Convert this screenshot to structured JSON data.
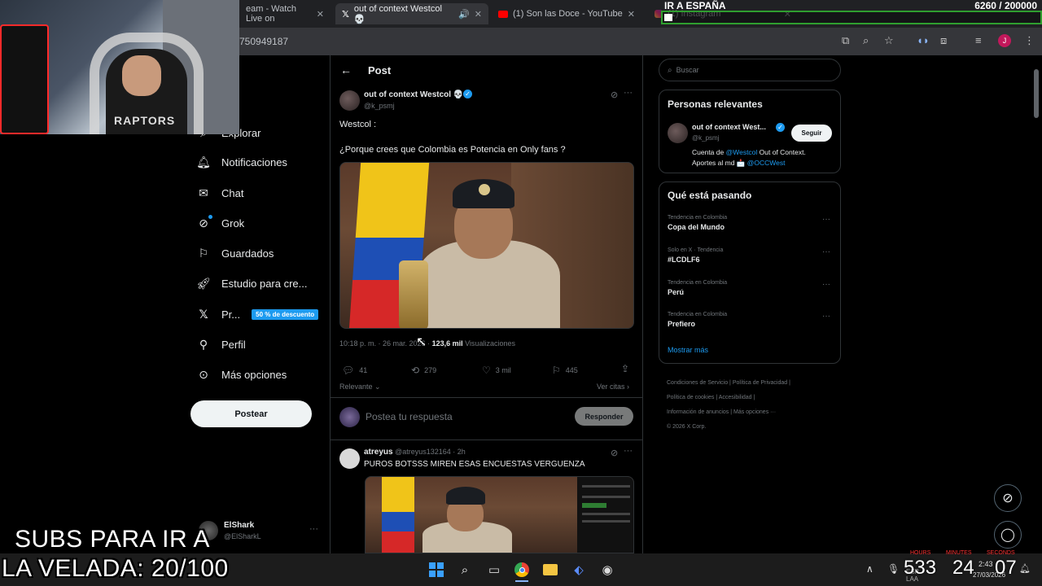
{
  "browser": {
    "tabs": [
      {
        "label": "eam - Watch Live on",
        "icon": "stream-icon"
      },
      {
        "label": "out of context Westcol 💀",
        "icon": "x-logo-icon",
        "active": true
      },
      {
        "label": "(1) Son las Doce - YouTube",
        "icon": "youtube-icon"
      },
      {
        "label": "(1) Instagram",
        "icon": "instagram-icon"
      }
    ],
    "address_fragment": "750949187",
    "profile_initial": "J"
  },
  "overlay": {
    "goal_title": "IR A ESPAÑA",
    "goal_count": "6260 / 200000",
    "subs_line1": "SUBS PARA IR A",
    "subs_line2": "LA VELADA: 20/100",
    "webcam_jersey_text": "RAPTORS",
    "partial_nav_home": "io"
  },
  "sidebar": {
    "items": [
      {
        "label": "Explorar",
        "icon": "search-icon"
      },
      {
        "label": "Notificaciones",
        "icon": "bell-icon"
      },
      {
        "label": "Chat",
        "icon": "mail-icon"
      },
      {
        "label": "Grok",
        "icon": "grok-icon"
      },
      {
        "label": "Guardados",
        "icon": "bookmark-icon"
      },
      {
        "label": "Estudio para cre...",
        "icon": "rocket-icon"
      },
      {
        "label": "Pr...",
        "icon": "x-logo-icon",
        "badge": "50 % de descuento"
      },
      {
        "label": "Perfil",
        "icon": "person-icon"
      },
      {
        "label": "Más opciones",
        "icon": "more-circle-icon"
      }
    ],
    "post_button": "Postear",
    "account_name": "ElShark",
    "account_handle": "@ElSharkL"
  },
  "post": {
    "header_title": "Post",
    "author_name": "out of context Westcol 💀",
    "author_handle": "@k_psmj",
    "text_line1": "Westcol :",
    "text_line2": "¿Porque crees que Colombia es Potencia en Only fans ?",
    "timestamp": "10:18 p. m. · 26 mar. 2026 · ",
    "views_count": "123,6 mil",
    "views_label": " Visualizaciones",
    "replies": "41",
    "reposts": "279",
    "likes": "3 mil",
    "bookmarks": "445",
    "relevance_label": "Relevante",
    "quotes_link": "Ver citas ›",
    "reply_placeholder": "Postea tu respuesta",
    "reply_button": "Responder"
  },
  "reply": {
    "author_name": "atreyus",
    "author_handle": "@atreyus132164",
    "time": "· 2h",
    "text": "PUROS BOTSSS MIREN ESAS ENCUESTAS VERGUENZA"
  },
  "right": {
    "search_placeholder": "Buscar",
    "relevant_title": "Personas relevantes",
    "relevant_name": "out of context West...",
    "relevant_handle": "@k_psmj",
    "follow_button": "Seguir",
    "bio_prefix": "Cuenta de ",
    "bio_mention1": "@Westcol",
    "bio_middle": " Out of Context.",
    "bio_line2_prefix": "Aportes al md 📩 ",
    "bio_mention2": "@OCCWest",
    "trends_title": "Qué está pasando",
    "trends": [
      {
        "meta": "Tendencia en Colombia",
        "name": "Copa del Mundo"
      },
      {
        "meta": "Solo en X · Tendencia",
        "name": "#LCDLF6"
      },
      {
        "meta": "Tendencia en Colombia",
        "name": "Perú"
      },
      {
        "meta": "Tendencia en Colombia",
        "name": "Prefiero"
      }
    ],
    "show_more": "Mostrar más",
    "footer_line1": [
      "Condiciones de Servicio",
      "Política de Privacidad"
    ],
    "footer_line2": [
      "Política de cookies",
      "Accesibilidad"
    ],
    "footer_line3": [
      "Información de anuncios",
      "Más opciones ···"
    ],
    "copyright": "© 2026 X Corp."
  },
  "taskbar": {
    "clock_time": "2:43",
    "clock_date": "27/03/2026",
    "lang": "ESP LAA",
    "counter_hours": "533",
    "counter_minutes": "24",
    "counter_seconds": "07",
    "hours_label": "HOURS",
    "minutes_label": "MINUTES",
    "seconds_label": "SECONDS"
  },
  "colors": {
    "accent": "#1d9bf0",
    "background": "#000000",
    "goal_border": "#2f9e2f",
    "badge": "#1d9bf0"
  }
}
